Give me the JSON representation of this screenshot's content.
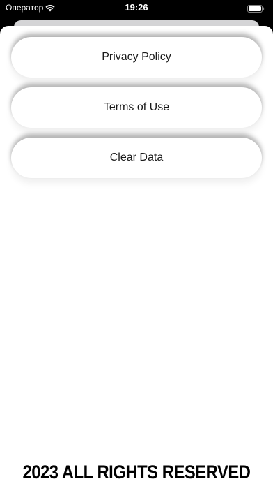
{
  "status_bar": {
    "carrier": "Оператор",
    "time": "19:26",
    "wifi_icon": "wifi-icon",
    "battery_icon": "battery-icon"
  },
  "settings": {
    "items": [
      {
        "label": "Privacy Policy"
      },
      {
        "label": "Terms of Use"
      },
      {
        "label": "Clear Data"
      }
    ]
  },
  "footer": {
    "text": "2023 ALL RIGHTS RESERVED"
  },
  "colors": {
    "background": "#ffffff",
    "text": "#000000"
  }
}
